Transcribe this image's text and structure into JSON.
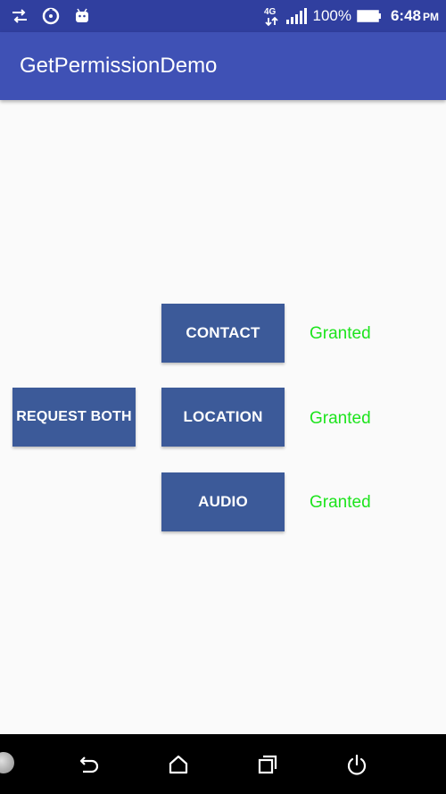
{
  "status_bar": {
    "network_label": "4G",
    "battery_percent": "100%",
    "time": "6:48",
    "ampm": "PM",
    "icons": [
      "data-transfer-icon",
      "sync-icon",
      "android-icon",
      "network-4g-icon",
      "signal-icon",
      "battery-icon"
    ]
  },
  "app_bar": {
    "title": "GetPermissionDemo"
  },
  "buttons": {
    "contact": "CONTACT",
    "location": "LOCATION",
    "audio": "AUDIO",
    "request_both": "REQUEST BOTH"
  },
  "permission_status": {
    "contact": "Granted",
    "location": "Granted",
    "audio": "Granted"
  },
  "colors": {
    "status_bar": "#303f9f",
    "app_bar": "#3f51b5",
    "button": "#3c5a99",
    "granted_text": "#1de41d",
    "background": "#fafafa"
  },
  "nav_bar": {
    "icons": [
      "back-icon",
      "home-icon",
      "recent-apps-icon",
      "power-icon"
    ]
  }
}
